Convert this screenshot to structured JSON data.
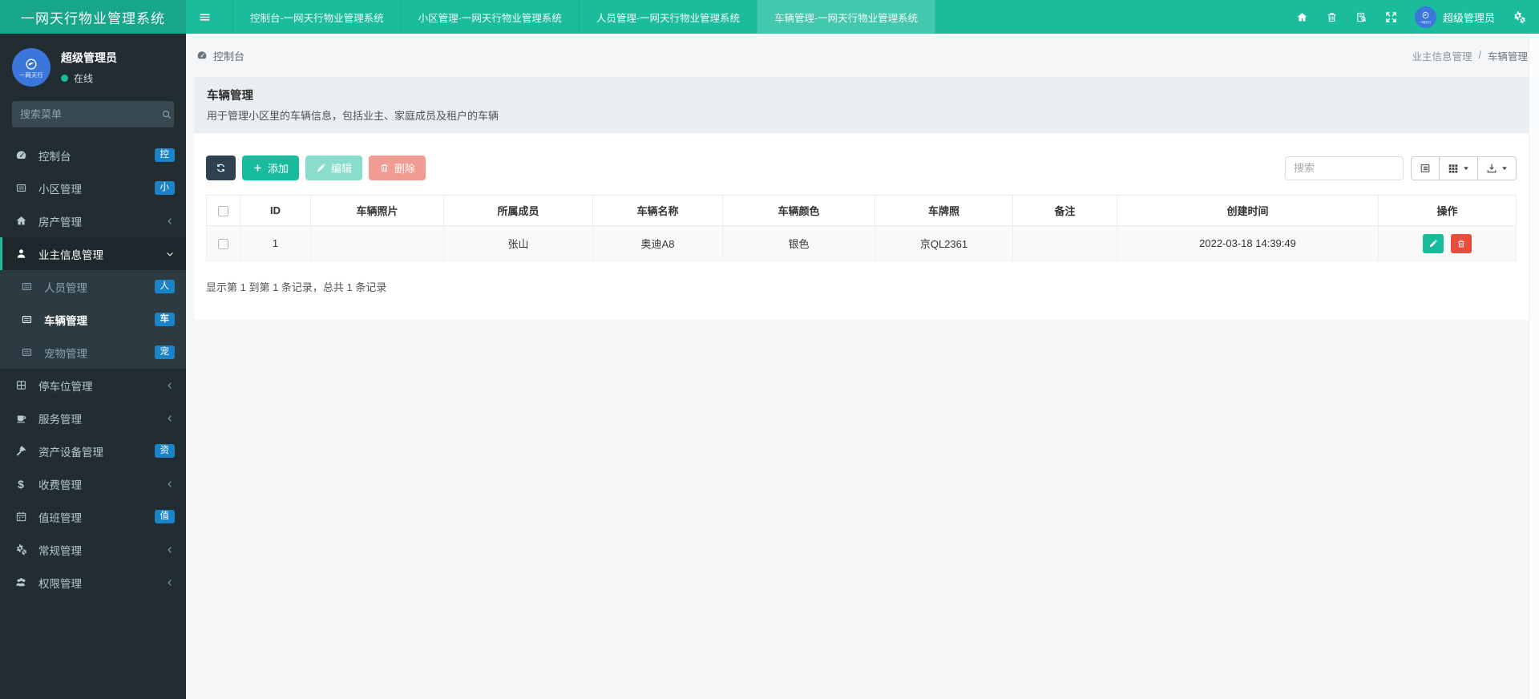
{
  "topbar": {
    "brand": "一网天行物业管理系统",
    "tabs": [
      {
        "label": "控制台-一网天行物业管理系统",
        "active": false
      },
      {
        "label": "小区管理-一网天行物业管理系统",
        "active": false
      },
      {
        "label": "人员管理-一网天行物业管理系统",
        "active": false
      },
      {
        "label": "车辆管理-一网天行物业管理系统",
        "active": true
      }
    ],
    "user_name": "超级管理员",
    "avatar_text": "一网天行"
  },
  "sidebar": {
    "user": {
      "name": "超级管理员",
      "status": "在线",
      "avatar_text": "一网天行"
    },
    "search_placeholder": "搜索菜单",
    "menu": [
      {
        "label": "控制台",
        "icon": "speedometer-icon",
        "badge": "控"
      },
      {
        "label": "小区管理",
        "icon": "table-icon",
        "badge": "小"
      },
      {
        "label": "房产管理",
        "icon": "home-icon",
        "chevron": "left"
      },
      {
        "label": "业主信息管理",
        "icon": "user-icon",
        "chevron": "down",
        "active": true,
        "submenu": [
          {
            "label": "人员管理",
            "icon": "table-icon",
            "badge": "人",
            "active": false
          },
          {
            "label": "车辆管理",
            "icon": "table-icon",
            "badge": "车",
            "active": true
          },
          {
            "label": "宠物管理",
            "icon": "table-icon",
            "badge": "宠",
            "active": false
          }
        ]
      },
      {
        "label": "停车位管理",
        "icon": "building-icon",
        "chevron": "left"
      },
      {
        "label": "服务管理",
        "icon": "cup-icon",
        "chevron": "left"
      },
      {
        "label": "资产设备管理",
        "icon": "gavel-icon",
        "badge": "资"
      },
      {
        "label": "收费管理",
        "icon": "dollar-icon",
        "chevron": "left"
      },
      {
        "label": "值班管理",
        "icon": "calendar-icon",
        "badge": "值"
      },
      {
        "label": "常规管理",
        "icon": "cogs-icon",
        "chevron": "left"
      },
      {
        "label": "权限管理",
        "icon": "users-icon",
        "chevron": "left"
      }
    ]
  },
  "breadcrumb": {
    "left": "控制台",
    "parent": "业主信息管理",
    "separator": "/",
    "current": "车辆管理"
  },
  "panel": {
    "title": "车辆管理",
    "subtitle": "用于管理小区里的车辆信息，包括业主、家庭成员及租户的车辆"
  },
  "toolbar": {
    "add_label": "添加",
    "edit_label": "编辑",
    "delete_label": "删除",
    "search_placeholder": "搜索"
  },
  "table": {
    "columns": [
      "ID",
      "车辆照片",
      "所属成员",
      "车辆名称",
      "车辆颜色",
      "车牌照",
      "备注",
      "创建时间",
      "操作"
    ],
    "rows": [
      {
        "id": "1",
        "photo": "",
        "member": "张山",
        "name": "奥迪A8",
        "color": "银色",
        "plate": "京QL2361",
        "remark": "",
        "created": "2022-03-18 14:39:49"
      }
    ]
  },
  "footer": {
    "summary": "显示第 1 到第 1 条记录，总共 1 条记录"
  },
  "colors": {
    "topbar": "#1abc9c",
    "brand_bg": "#17a689",
    "sidebar_bg": "#222d32",
    "submenu_bg": "#2c3b41",
    "badge_blue": "#1c84c6",
    "accent_green": "#18bc9c",
    "danger_red": "#e74c3c",
    "dark_button": "#2f4050",
    "avatar_blue": "#3b76dd",
    "panel_head_bg": "#e9eef1",
    "page_bg": "#f4f6f8",
    "row_stripe": "#f9f9f9"
  }
}
